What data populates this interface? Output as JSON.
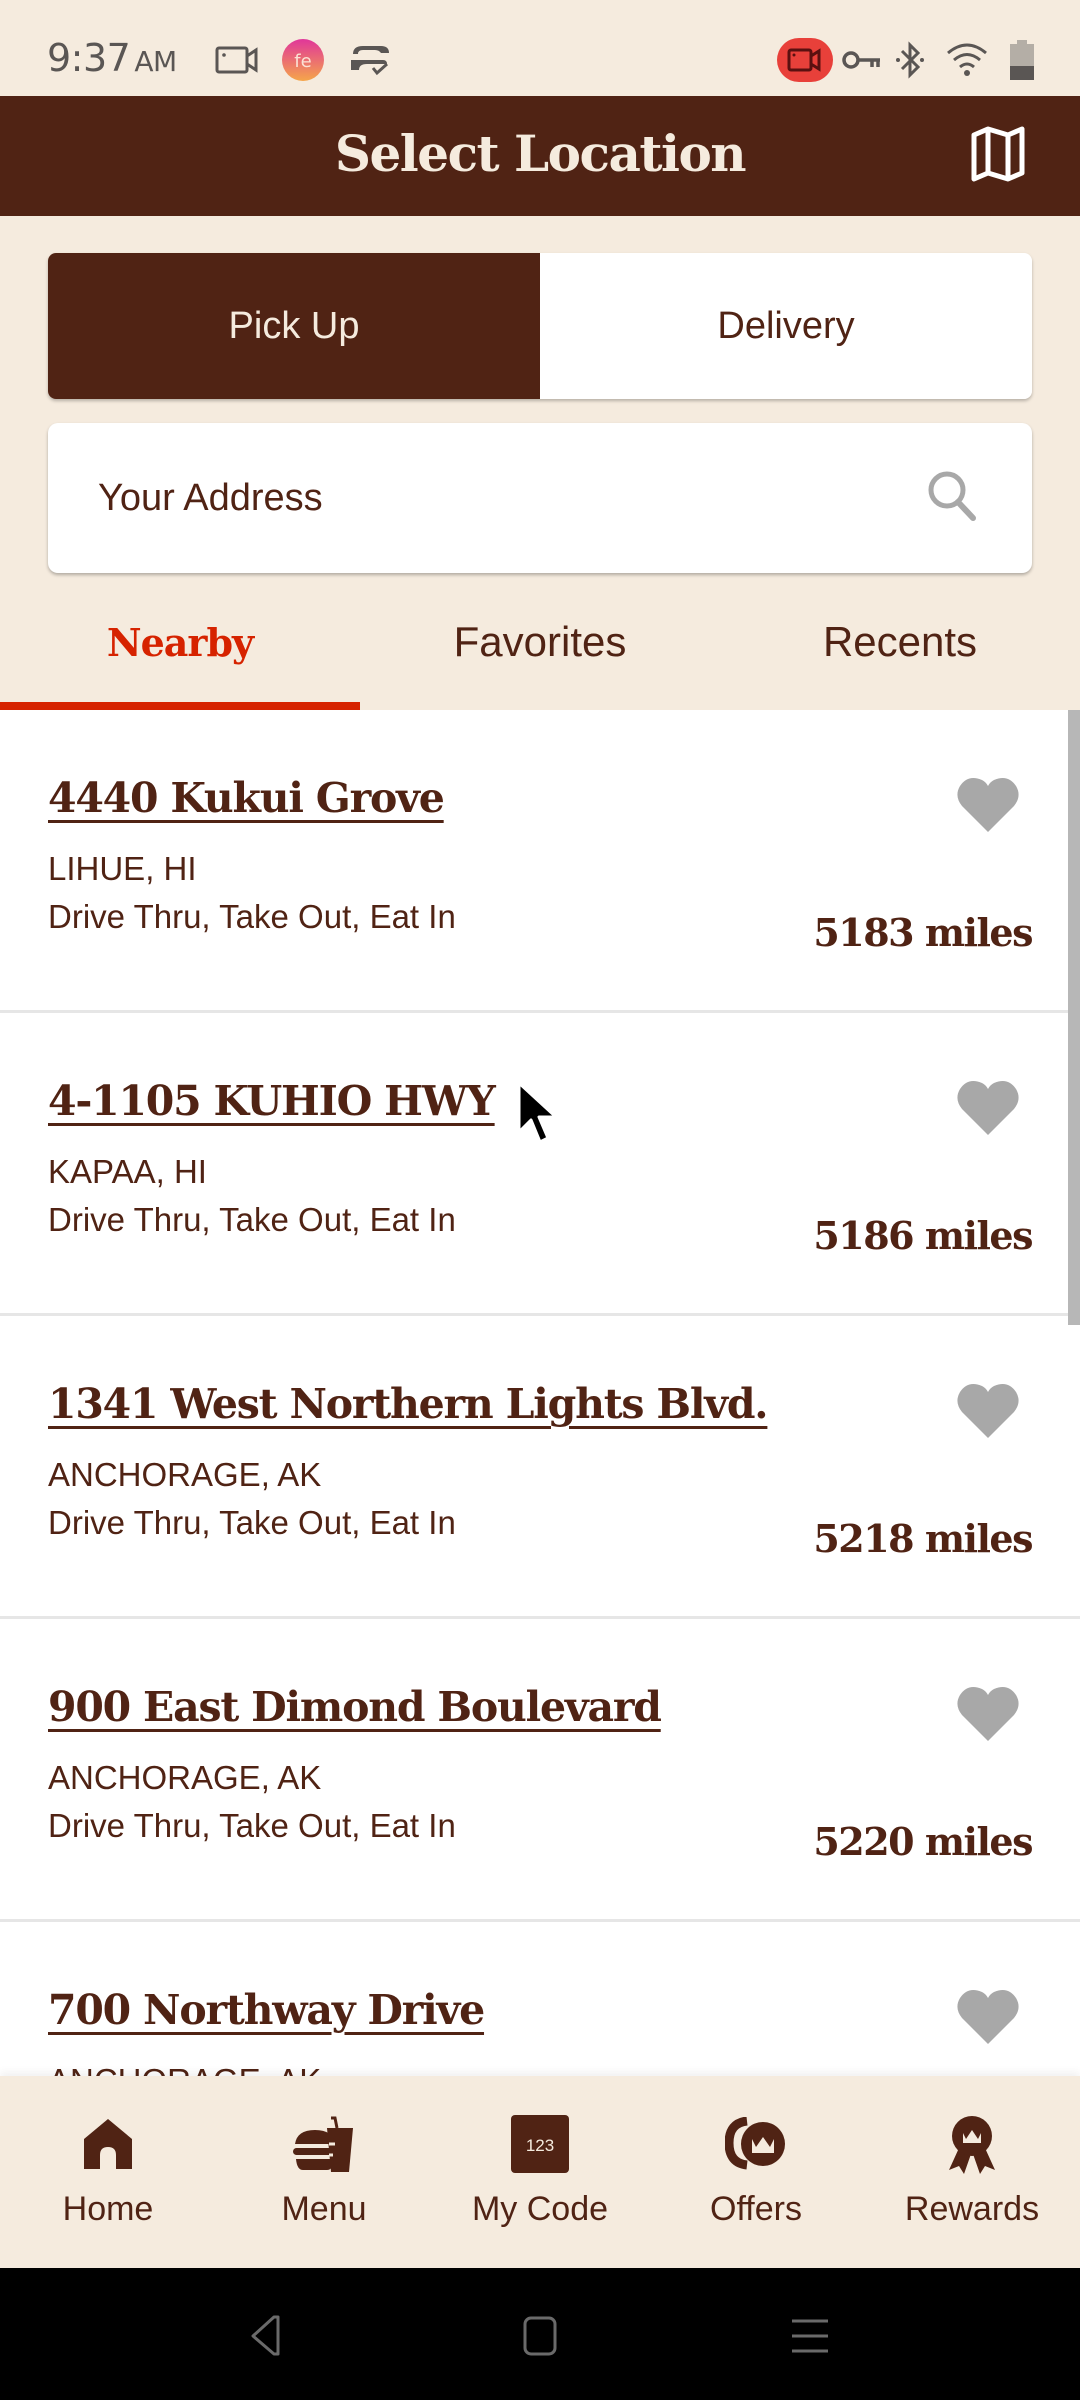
{
  "status_bar": {
    "time": "9:37",
    "ampm": "AM",
    "left_icons": [
      "screen-record-icon",
      "app-notification-icon",
      "sync-check-icon"
    ],
    "right_icons": [
      "recording-active-icon",
      "vpn-key-icon",
      "bluetooth-icon",
      "wifi-icon",
      "battery-icon"
    ]
  },
  "header": {
    "title": "Select Location",
    "map_icon": "map-icon"
  },
  "order_type": {
    "options": [
      {
        "label": "Pick Up",
        "selected": true
      },
      {
        "label": "Delivery",
        "selected": false
      }
    ]
  },
  "address": {
    "placeholder": "Your Address",
    "value": "",
    "icon": "search-icon"
  },
  "tabs": [
    {
      "label": "Nearby",
      "active": true
    },
    {
      "label": "Favorites",
      "active": false
    },
    {
      "label": "Recents",
      "active": false
    }
  ],
  "locations": [
    {
      "name": "4440 Kukui Grove",
      "city": "LIHUE, HI",
      "services": "Drive Thru, Take Out, Eat In",
      "distance": "5183 miles",
      "favorite": false
    },
    {
      "name": "4-1105 KUHIO HWY",
      "city": "KAPAA, HI",
      "services": "Drive Thru, Take Out, Eat In",
      "distance": "5186 miles",
      "favorite": false
    },
    {
      "name": "1341 West Northern Lights Blvd.",
      "city": "ANCHORAGE, AK",
      "services": "Drive Thru, Take Out, Eat In",
      "distance": "5218 miles",
      "favorite": false
    },
    {
      "name": "900 East Dimond Boulevard",
      "city": "ANCHORAGE, AK",
      "services": "Drive Thru, Take Out, Eat In",
      "distance": "5220 miles",
      "favorite": false
    },
    {
      "name": "700 Northway Drive",
      "city": "ANCHORAGE, AK",
      "services": "",
      "distance": "",
      "favorite": false
    }
  ],
  "bottom_nav": [
    {
      "label": "Home",
      "icon": "home-icon"
    },
    {
      "label": "Menu",
      "icon": "burger-drink-icon"
    },
    {
      "label": "My Code",
      "icon": "code-123-icon",
      "icon_text": "123"
    },
    {
      "label": "Offers",
      "icon": "offers-coins-icon"
    },
    {
      "label": "Rewards",
      "icon": "rewards-ribbon-icon"
    }
  ],
  "system_nav": [
    "back-icon",
    "home-square-icon",
    "recents-menu-icon"
  ],
  "colors": {
    "brand_brown": "#502314",
    "cream": "#f5ebde",
    "accent_red": "#d62300",
    "heart_gray": "#a8a8a8"
  }
}
